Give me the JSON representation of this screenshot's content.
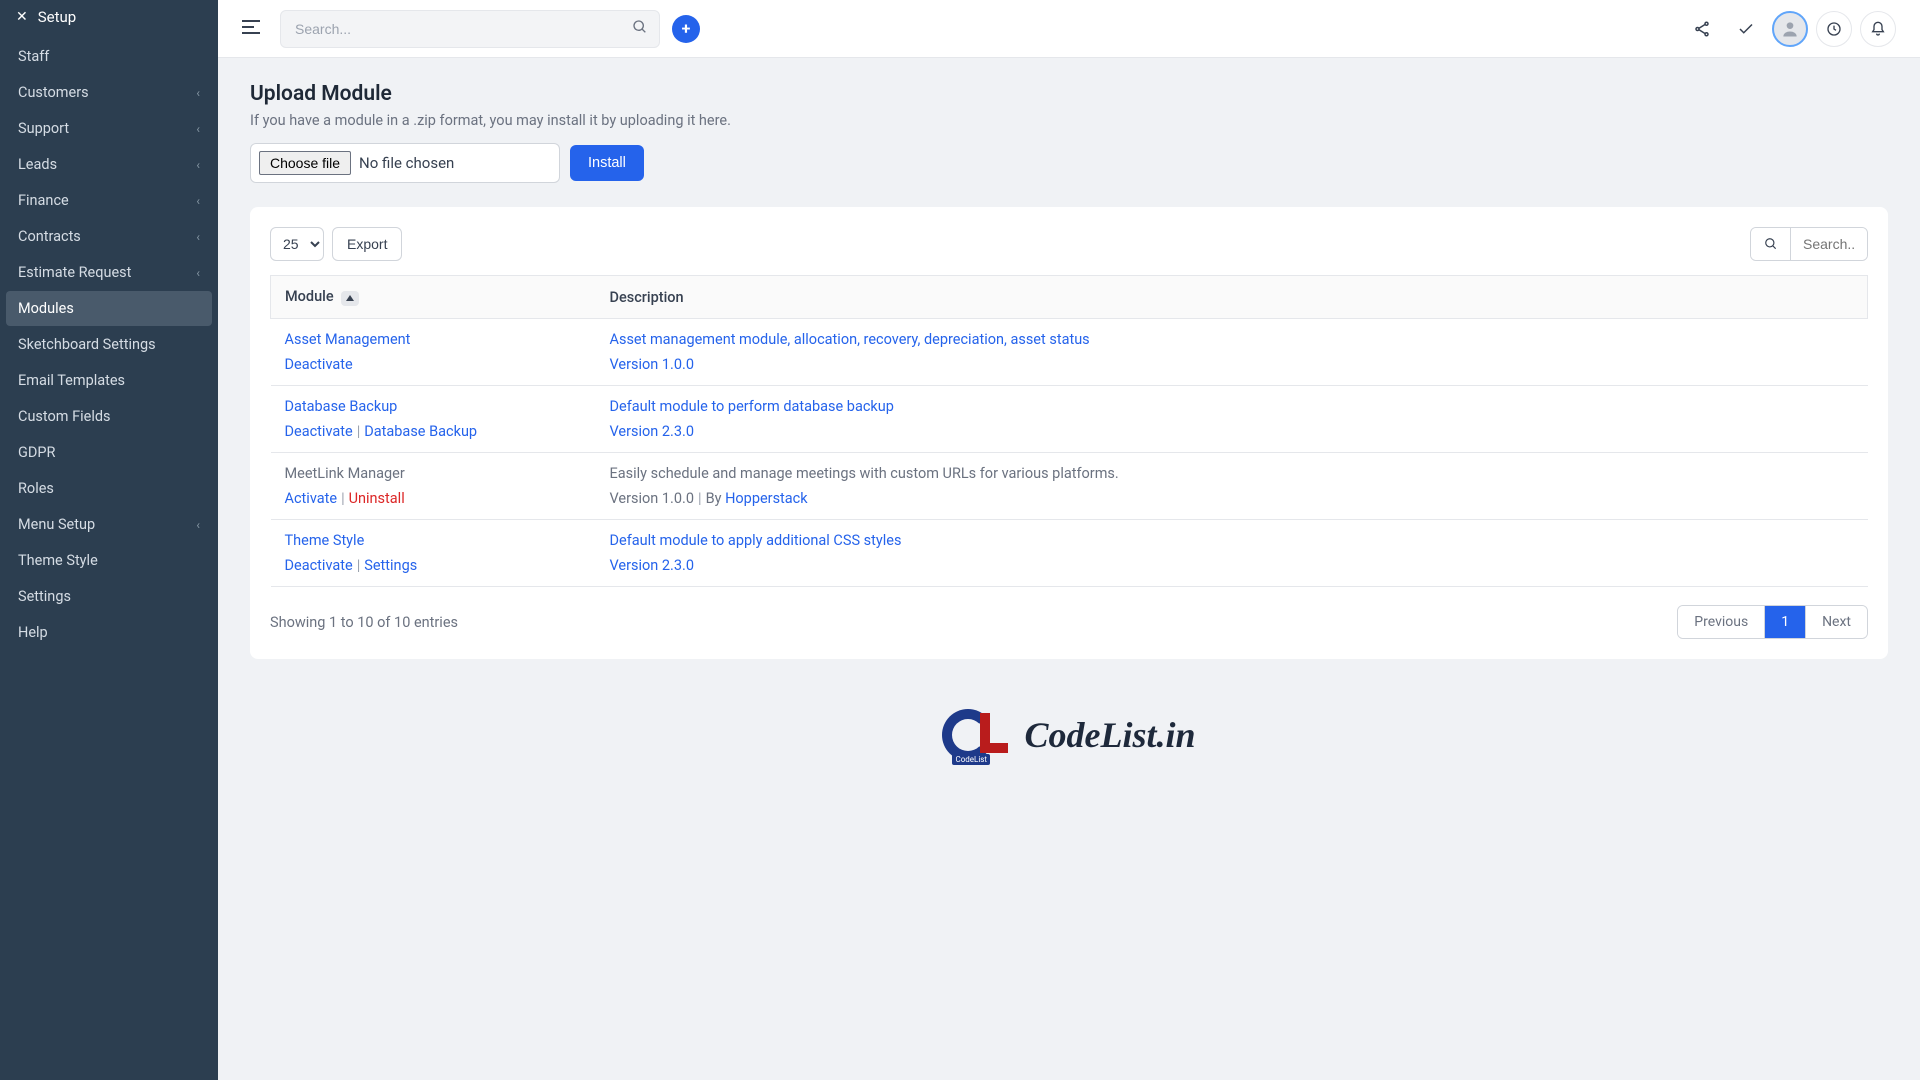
{
  "sidebar": {
    "header": "Setup",
    "items": [
      {
        "label": "Staff",
        "hasChildren": false
      },
      {
        "label": "Customers",
        "hasChildren": true
      },
      {
        "label": "Support",
        "hasChildren": true
      },
      {
        "label": "Leads",
        "hasChildren": true
      },
      {
        "label": "Finance",
        "hasChildren": true
      },
      {
        "label": "Contracts",
        "hasChildren": true
      },
      {
        "label": "Estimate Request",
        "hasChildren": true
      },
      {
        "label": "Modules",
        "hasChildren": false,
        "active": true
      },
      {
        "label": "Sketchboard Settings",
        "hasChildren": false
      },
      {
        "label": "Email Templates",
        "hasChildren": false
      },
      {
        "label": "Custom Fields",
        "hasChildren": false
      },
      {
        "label": "GDPR",
        "hasChildren": false
      },
      {
        "label": "Roles",
        "hasChildren": false
      },
      {
        "label": "Menu Setup",
        "hasChildren": true
      },
      {
        "label": "Theme Style",
        "hasChildren": false
      },
      {
        "label": "Settings",
        "hasChildren": false
      },
      {
        "label": "Help",
        "hasChildren": false
      }
    ]
  },
  "topbar": {
    "search_placeholder": "Search..."
  },
  "page": {
    "title": "Upload Module",
    "subtitle": "If you have a module in a .zip format, you may install it by uploading it here.",
    "choose_file": "Choose file",
    "no_file": "No file chosen",
    "install": "Install"
  },
  "toolbar": {
    "page_size": "25",
    "export": "Export",
    "search_placeholder": "Search.."
  },
  "table": {
    "headers": {
      "module": "Module",
      "description": "Description"
    },
    "rows": [
      {
        "name": "Asset Management",
        "description": "Asset management module, allocation, recovery, depreciation, asset status",
        "version": "Version 1.0.0",
        "active": true,
        "actions": [
          {
            "label": "Deactivate",
            "type": "normal"
          }
        ]
      },
      {
        "name": "Database Backup",
        "description": "Default module to perform database backup",
        "version": "Version 2.3.0",
        "active": true,
        "actions": [
          {
            "label": "Deactivate",
            "type": "normal"
          },
          {
            "label": "Database Backup",
            "type": "normal"
          }
        ]
      },
      {
        "name": "MeetLink Manager",
        "description": "Easily schedule and manage meetings with custom URLs for various platforms.",
        "version": "Version 1.0.0",
        "by": "By",
        "author": "Hopperstack",
        "active": false,
        "actions": [
          {
            "label": "Activate",
            "type": "activate"
          },
          {
            "label": "Uninstall",
            "type": "uninstall"
          }
        ]
      },
      {
        "name": "Theme Style",
        "description": "Default module to apply additional CSS styles",
        "version": "Version 2.3.0",
        "active": true,
        "actions": [
          {
            "label": "Deactivate",
            "type": "normal"
          },
          {
            "label": "Settings",
            "type": "normal"
          }
        ]
      }
    ]
  },
  "footer": {
    "entries": "Showing 1 to 10 of 10 entries",
    "prev": "Previous",
    "page": "1",
    "next": "Next"
  },
  "logo": {
    "sub": "CodeList",
    "text": "CodeList.in"
  }
}
